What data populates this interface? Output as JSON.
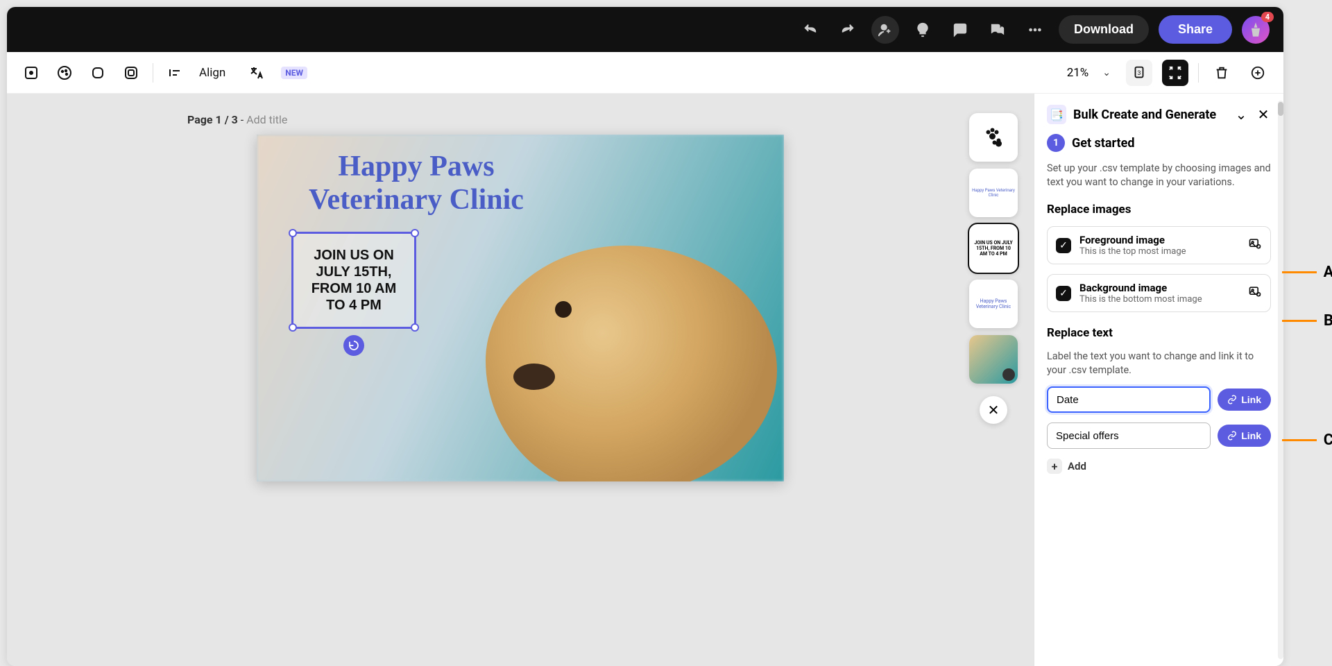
{
  "topbar": {
    "download_label": "Download",
    "share_label": "Share",
    "notification_count": "4"
  },
  "toolbar": {
    "align_label": "Align",
    "new_badge": "NEW",
    "zoom": "21%",
    "page_count_badge": "3"
  },
  "canvas": {
    "page_label_prefix": "Page 1 / 3",
    "page_label_separator": " - ",
    "page_title_placeholder": "Add title",
    "poster_title": "Happy Paws\nVeterinary Clinic",
    "selected_text": "JOIN US ON\nJULY 15TH,\nFROM 10 AM\nTO 4 PM"
  },
  "layers": {
    "items": [
      {
        "type": "paws",
        "label": ""
      },
      {
        "type": "title",
        "label": "Happy Paws Veterinary Clinic"
      },
      {
        "type": "text",
        "label": "JOIN US ON JULY 15TH, FROM 10 AM TO 4 PM",
        "selected": true
      },
      {
        "type": "title2",
        "label": "Happy Paws Veterinary Clinic"
      },
      {
        "type": "image",
        "label": "",
        "badge": true
      }
    ]
  },
  "panel": {
    "title": "Bulk Create and Generate",
    "step_num": "1",
    "step_title": "Get started",
    "step_desc": "Set up your .csv template by choosing images and text you want to change in your variations.",
    "replace_images_title": "Replace images",
    "images": [
      {
        "title": "Foreground image",
        "sub": "This is the top most image"
      },
      {
        "title": "Background image",
        "sub": "This is the bottom most image"
      }
    ],
    "replace_text_title": "Replace text",
    "replace_text_desc": "Label the text you want to change and link it to your .csv template.",
    "text_fields": [
      {
        "value": "Date",
        "focused": true
      },
      {
        "value": "Special offers",
        "focused": false
      }
    ],
    "link_label": "Link",
    "add_label": "Add"
  },
  "callouts": {
    "A": "A",
    "B": "B",
    "C": "C"
  }
}
